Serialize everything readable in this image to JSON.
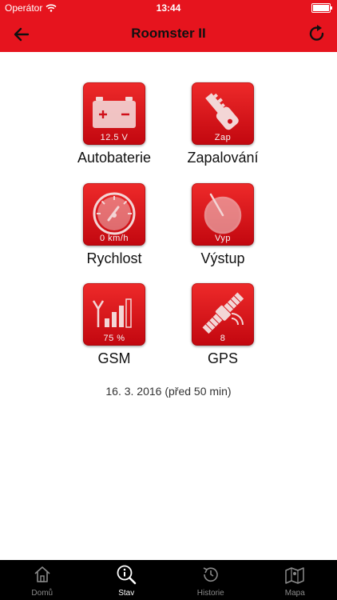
{
  "status_bar": {
    "carrier": "Operátor",
    "time": "13:44"
  },
  "header": {
    "title": "Roomster II"
  },
  "tiles": [
    {
      "label": "Autobaterie",
      "value": "12.5 V",
      "icon": "car-battery-icon"
    },
    {
      "label": "Zapalování",
      "value": "Zap",
      "icon": "ignition-key-icon"
    },
    {
      "label": "Rychlost",
      "value": "0 km/h",
      "icon": "speedometer-icon"
    },
    {
      "label": "Výstup",
      "value": "Vyp",
      "icon": "output-dial-icon"
    },
    {
      "label": "GSM",
      "value": "75 %",
      "icon": "gsm-signal-icon"
    },
    {
      "label": "GPS",
      "value": "8",
      "icon": "gps-satellite-icon"
    }
  ],
  "last_update": "16. 3. 2016 (před 50 min)",
  "tab_bar": {
    "active_tab": "Stav",
    "tabs": [
      {
        "label": "Domů",
        "icon": "home-icon"
      },
      {
        "label": "Stav",
        "icon": "info-search-icon"
      },
      {
        "label": "Historie",
        "icon": "history-icon"
      },
      {
        "label": "Mapa",
        "icon": "map-icon"
      }
    ]
  },
  "colors": {
    "accent": "#e6141e",
    "tile_top": "#ee2a2a",
    "tile_bottom": "#c2070f",
    "tab_bar_bg": "#000000"
  }
}
